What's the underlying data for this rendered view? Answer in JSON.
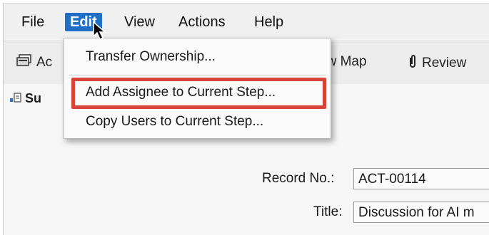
{
  "menubar": {
    "items": [
      {
        "label": "File"
      },
      {
        "label": "Edit"
      },
      {
        "label": "View"
      },
      {
        "label": "Actions"
      },
      {
        "label": "Help"
      }
    ],
    "active_index": 1
  },
  "toolbar": {
    "left_label": "Ac",
    "map_label": "ew Map",
    "review_label": "Review"
  },
  "tab": {
    "label": "Su"
  },
  "edit_menu": {
    "items": [
      {
        "label": "Transfer Ownership..."
      },
      {
        "label": "Add Assignee to Current Step..."
      },
      {
        "label": "Copy Users to Current Step..."
      }
    ],
    "highlighted_index": 1
  },
  "form": {
    "record_no_label": "Record No.:",
    "record_no_value": "ACT-00114",
    "title_label": "Title:",
    "title_value": "Discussion for AI m"
  },
  "colors": {
    "menu_active": "#1f6fc6",
    "annotation_box": "#d9443a"
  },
  "icons": [
    "toolbar-action-icon",
    "paperclip-icon",
    "tab-document-icon",
    "mouse-pointer-icon"
  ]
}
